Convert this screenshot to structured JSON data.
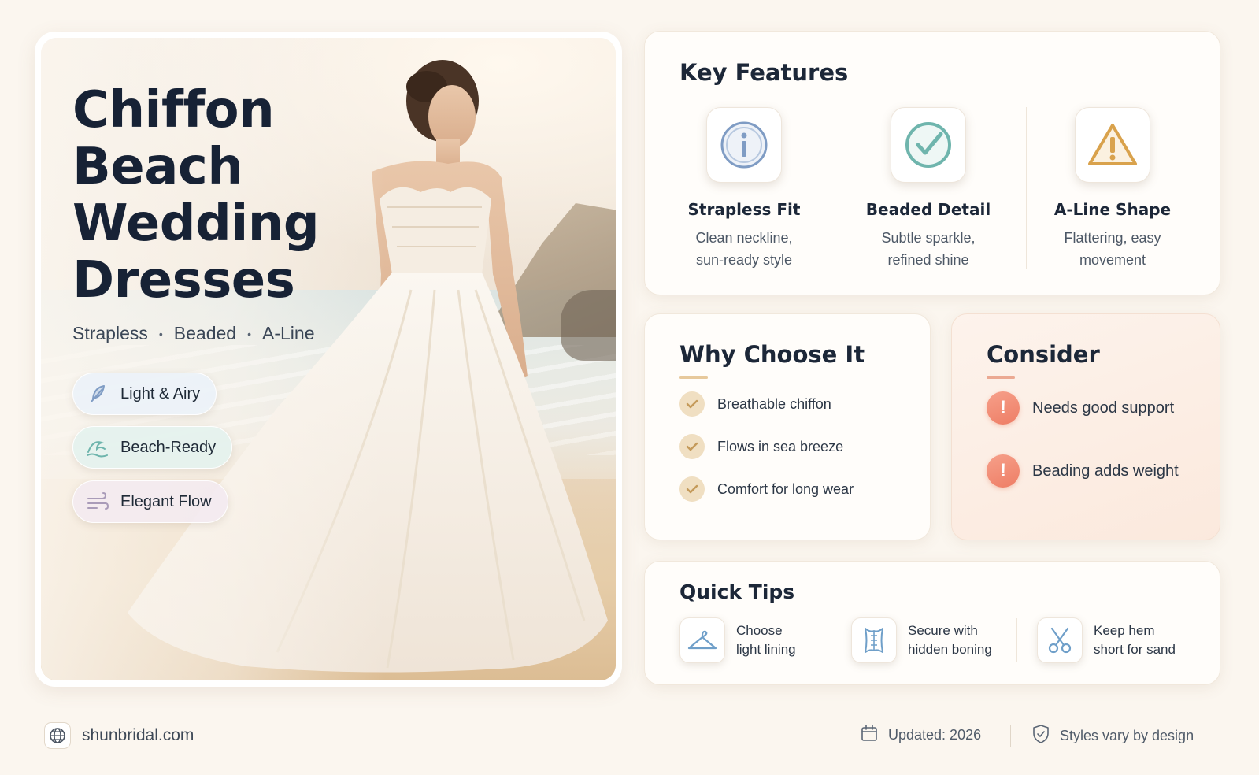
{
  "hero": {
    "title_lines": [
      "Chiffon",
      "Beach",
      "Wedding",
      "Dresses"
    ],
    "tags": [
      "Strapless",
      "Beaded",
      "A-Line"
    ],
    "tag_separator": "•",
    "pills": [
      {
        "label": "Light & Airy",
        "icon": "feather-icon"
      },
      {
        "label": "Beach-Ready",
        "icon": "wave-icon"
      },
      {
        "label": "Elegant Flow",
        "icon": "wind-icon"
      }
    ]
  },
  "features": {
    "heading": "Key Features",
    "items": [
      {
        "title": "Strapless Fit",
        "desc_lines": [
          "Clean neckline,",
          "sun-ready style"
        ],
        "icon": "info-icon"
      },
      {
        "title": "Beaded Detail",
        "desc_lines": [
          "Subtle sparkle,",
          "refined shine"
        ],
        "icon": "check-circle-icon"
      },
      {
        "title": "A-Line Shape",
        "desc_lines": [
          "Flattering, easy",
          "movement"
        ],
        "icon": "warning-triangle-icon"
      }
    ]
  },
  "why": {
    "heading": "Why Choose It",
    "items": [
      "Breathable chiffon",
      "Flows in sea breeze",
      "Comfort for long wear"
    ]
  },
  "consider": {
    "heading": "Consider",
    "items": [
      "Needs good support",
      "Beading adds weight"
    ],
    "alert_glyph": "!"
  },
  "tips": {
    "heading": "Quick Tips",
    "items": [
      {
        "lines": [
          "Choose",
          "light lining"
        ],
        "icon": "hanger-icon"
      },
      {
        "lines": [
          "Secure with",
          "hidden boning"
        ],
        "icon": "corset-icon"
      },
      {
        "lines": [
          "Keep hem",
          "short for sand"
        ],
        "icon": "scissors-icon"
      }
    ]
  },
  "footer": {
    "site": "shunbridal.com",
    "updated": "Updated: 2026",
    "note": "Styles vary by design"
  },
  "colors": {
    "background": "#fbf6ef",
    "title": "#172235",
    "accent_gold": "#e7c99c",
    "accent_coral": "#ee7d65",
    "icon_blue": "#7f9cc4",
    "icon_teal": "#6fb5ad",
    "icon_amber": "#d9a24c"
  }
}
